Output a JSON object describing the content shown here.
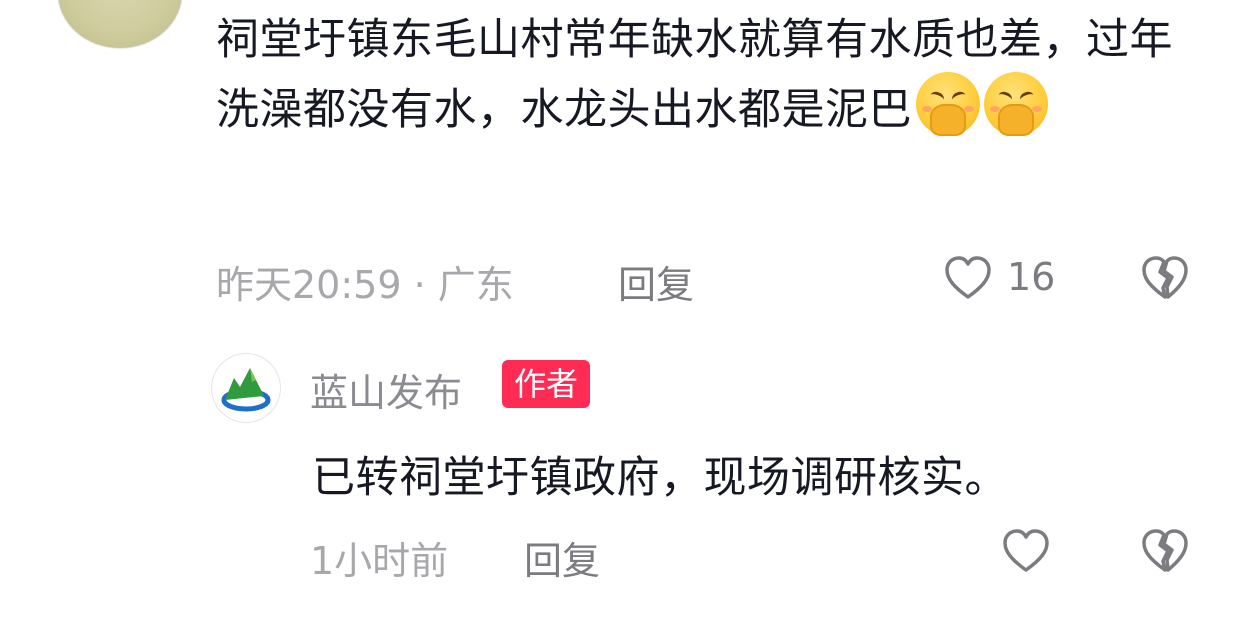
{
  "comment": {
    "text": "祠堂圩镇东毛山村常年缺水就算有水质也差，过年洗澡都没有水，水龙头出水都是泥巴",
    "emoji": "pleading-hands-emoji",
    "time_location": "昨天20:59 · 广东",
    "reply_label": "回复",
    "like_count": "16"
  },
  "reply": {
    "author_name": "蓝山发布",
    "badge": "作者",
    "text": "已转祠堂圩镇政府，现场调研核实。",
    "time": "1小时前",
    "reply_label": "回复"
  },
  "colors": {
    "badge_bg": "#fe2c55",
    "meta_gray": "#a8a8ac",
    "icon_gray": "#7b7b80"
  }
}
